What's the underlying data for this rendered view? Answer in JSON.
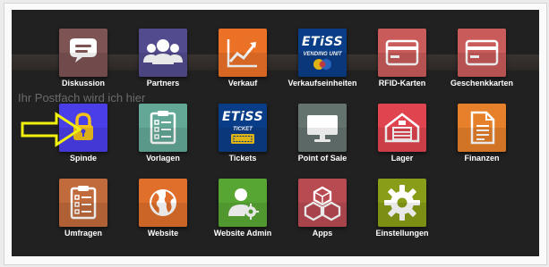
{
  "background_text": "Ihr Postfach wird ich hier",
  "apps": [
    {
      "label": "Diskussion",
      "icon": "speech-bubble-icon",
      "color": "#7d5353",
      "selected": false
    },
    {
      "label": "Partners",
      "icon": "user-group-icon",
      "color": "#524c8e",
      "selected": false
    },
    {
      "label": "Verkauf",
      "icon": "trend-chart-icon",
      "color": "#eb7127",
      "selected": false
    },
    {
      "label": "Verkaufseinheiten",
      "icon": "etiss-vending-unit-icon",
      "color": "#0a3d87",
      "selected": false,
      "badge": {
        "brand": "ETiSS",
        "caption": "VENDING UNIT"
      }
    },
    {
      "label": "RFID-Karten",
      "icon": "credit-card-icon",
      "color": "#c95b5b",
      "selected": false
    },
    {
      "label": "Geschenkkarten",
      "icon": "credit-card-icon",
      "color": "#c95b5b",
      "selected": false
    },
    {
      "label": "Spinde",
      "icon": "padlock-icon",
      "color": "#4a3ee8",
      "selected": true
    },
    {
      "label": "Vorlagen",
      "icon": "clipboard-list-icon",
      "color": "#63a897",
      "selected": false
    },
    {
      "label": "Tickets",
      "icon": "etiss-ticket-icon",
      "color": "#0a3d87",
      "selected": false,
      "badge": {
        "brand": "ETiSS",
        "caption": "TICKET"
      }
    },
    {
      "label": "Point of Sale",
      "icon": "monitor-icon",
      "color": "#65736f",
      "selected": false
    },
    {
      "label": "Lager",
      "icon": "warehouse-icon",
      "color": "#e0454f",
      "selected": false
    },
    {
      "label": "Finanzen",
      "icon": "document-icon",
      "color": "#e6802a",
      "selected": false
    },
    {
      "label": "Umfragen",
      "icon": "clipboard-list-icon",
      "color": "#c16a3b",
      "selected": false
    },
    {
      "label": "Website",
      "icon": "globe-icon",
      "color": "#e06f2b",
      "selected": false
    },
    {
      "label": "Website Admin",
      "icon": "user-admin-icon",
      "color": "#57a633",
      "selected": false
    },
    {
      "label": "Apps",
      "icon": "cubes-icon",
      "color": "#b84a52",
      "selected": false
    },
    {
      "label": "Einstellungen",
      "icon": "gear-icon",
      "color": "#8a9d18",
      "selected": false
    }
  ],
  "pointer": {
    "icon": "pointer-arrow-icon",
    "color": "#f2f00d"
  }
}
